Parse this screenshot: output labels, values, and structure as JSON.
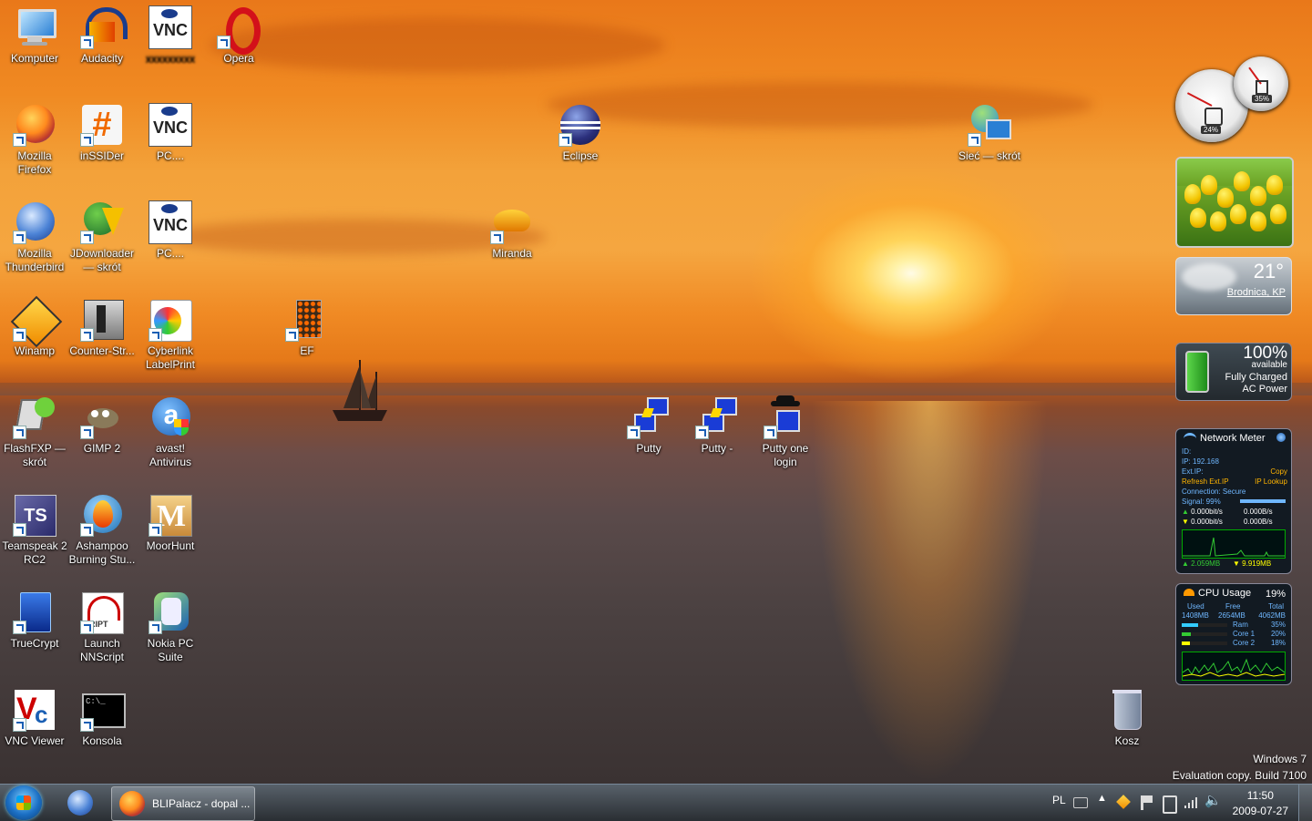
{
  "desktop": {
    "icons": [
      {
        "label": "Komputer",
        "icon": "computer-icon"
      },
      {
        "label": "Audacity",
        "icon": "audacity-icon"
      },
      {
        "label": "",
        "icon": "vnc-icon"
      },
      {
        "label": "Opera",
        "icon": "opera-icon"
      },
      {
        "label": "Mozilla Firefox",
        "icon": "firefox-icon"
      },
      {
        "label": "inSSIDer",
        "icon": "inssider-icon"
      },
      {
        "label": "PC....",
        "icon": "vnc-icon"
      },
      {
        "label": "Eclipse",
        "icon": "eclipse-icon"
      },
      {
        "label": "Sieć — skrót",
        "icon": "network-icon"
      },
      {
        "label": "Mozilla Thunderbird",
        "icon": "thunderbird-icon"
      },
      {
        "label": "JDownloader — skrót",
        "icon": "jdownloader-icon"
      },
      {
        "label": "PC....",
        "icon": "vnc-icon"
      },
      {
        "label": "Miranda",
        "icon": "miranda-icon"
      },
      {
        "label": "Winamp",
        "icon": "winamp-icon"
      },
      {
        "label": "Counter-Str...",
        "icon": "counter-strike-icon"
      },
      {
        "label": "Cyberlink LabelPrint",
        "icon": "labelprint-icon"
      },
      {
        "label": "EF",
        "icon": "ef-icon"
      },
      {
        "label": "FlashFXP — skrót",
        "icon": "flashfxp-icon"
      },
      {
        "label": "GIMP 2",
        "icon": "gimp-icon"
      },
      {
        "label": "avast! Antivirus",
        "icon": "avast-icon"
      },
      {
        "label": "Putty",
        "icon": "putty-icon"
      },
      {
        "label": "Putty -",
        "icon": "putty-icon"
      },
      {
        "label": "Putty one login",
        "icon": "putty-login-icon"
      },
      {
        "label": "Teamspeak 2 RC2",
        "icon": "teamspeak-icon"
      },
      {
        "label": "Ashampoo Burning Stu...",
        "icon": "ashampoo-icon"
      },
      {
        "label": "MoorHunt",
        "icon": "moorhunt-icon"
      },
      {
        "label": "TrueCrypt",
        "icon": "truecrypt-icon"
      },
      {
        "label": "Launch NNScript",
        "icon": "nnscript-icon"
      },
      {
        "label": "Nokia PC Suite",
        "icon": "nokia-icon"
      },
      {
        "label": "VNC Viewer",
        "icon": "vnc-viewer-icon"
      },
      {
        "label": "Konsola",
        "icon": "console-icon"
      },
      {
        "label": "Kosz",
        "icon": "recycle-bin-icon"
      }
    ]
  },
  "gadgets": {
    "meter": {
      "cpu_pct": "24%",
      "mem_pct": "35%",
      "cpu_level": 0.24,
      "mem_level": 0.35
    },
    "weather": {
      "temp": "21°",
      "city": "Brodnica, KP"
    },
    "battery": {
      "pct": "100%",
      "available": "available",
      "status": "Fully Charged",
      "power": "AC Power"
    },
    "network": {
      "title": "Network Meter",
      "id": "ID:",
      "ip": "IP: 192.168",
      "ext_ip": "Ext.IP:",
      "copy": "Copy",
      "refresh": "Refresh Ext.IP",
      "lookup": "IP Lookup",
      "connection": "Connection: Secure",
      "signal": "Signal: 99%",
      "up_rate": "0.000bit/s",
      "up_rate2": "0.000B/s",
      "down_rate": "0.000bit/s",
      "down_rate2": "0.000B/s",
      "up_total": "2.059MB",
      "down_total": "9.919MB"
    },
    "cpu": {
      "title": "CPU Usage",
      "pct": "19%",
      "used_lbl": "Used",
      "free_lbl": "Free",
      "total_lbl": "Total",
      "used": "1408MB",
      "free": "2654MB",
      "total": "4062MB",
      "ram_lbl": "Ram",
      "ram": "35%",
      "core1_lbl": "Core 1",
      "core1": "20%",
      "core2_lbl": "Core 2",
      "core2": "18%"
    }
  },
  "watermark": {
    "line1": "Windows 7",
    "line2": "Evaluation copy. Build 7100"
  },
  "taskbar": {
    "task_label": "BLIPalacz - dopal ...",
    "lang": "PL",
    "time": "11:50",
    "date": "2009-07-27"
  },
  "colors": {
    "accent": "#1b6fc4",
    "sky": "#f08a22",
    "sea": "#4b4141"
  }
}
